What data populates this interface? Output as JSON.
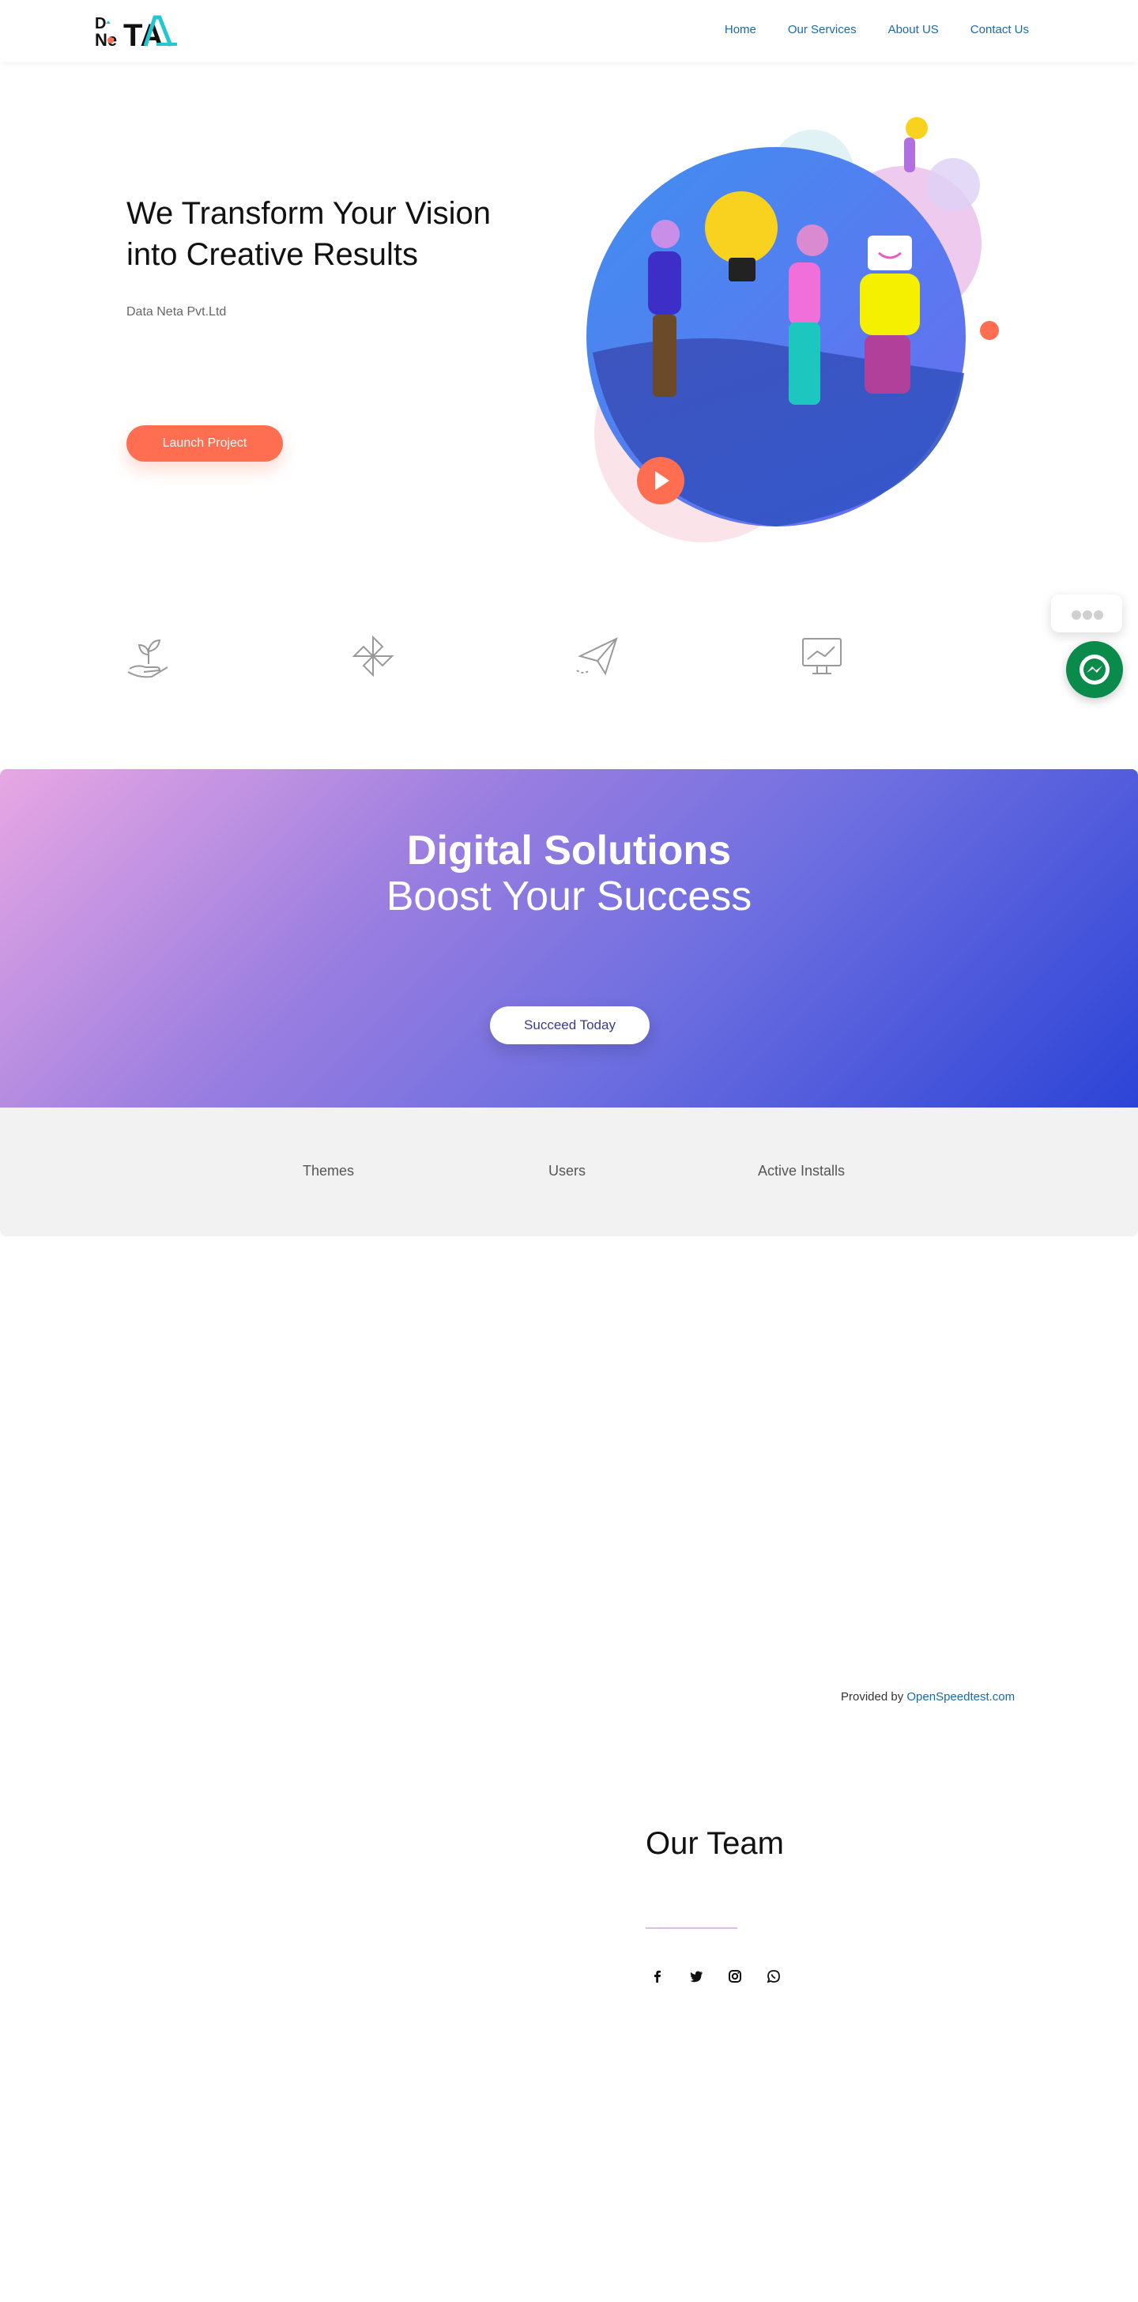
{
  "header": {
    "logo": {
      "top": "D",
      "mid": "Ne",
      "big": "TA"
    },
    "nav": [
      "Home",
      "Our Services",
      "About US",
      "Contact Us"
    ]
  },
  "hero": {
    "title_line1": "We Transform Your Vision",
    "title_line2": "into Creative Results",
    "subtitle": "Data Neta Pvt.Ltd",
    "button": "Launch Project"
  },
  "features": {
    "icons": [
      "plant-in-hand-icon",
      "pinwheel-icon",
      "paper-plane-icon",
      "monitor-chart-icon"
    ]
  },
  "banner": {
    "title": "Digital Solutions",
    "subtitle": "Boost Your Success",
    "button": "Succeed Today"
  },
  "stats": {
    "labels": [
      "Themes",
      "Users",
      "Active Installs"
    ]
  },
  "provided": {
    "prefix": "Provided by",
    "link": "OpenSpeedtest.com"
  },
  "team": {
    "title": "Our Team",
    "social": [
      "facebook-icon",
      "twitter-icon",
      "instagram-icon",
      "whatsapp-icon"
    ]
  },
  "colors": {
    "accent": "#ff6e50",
    "nav_link": "#1a6aa8",
    "chat": "#0a8a4b"
  }
}
